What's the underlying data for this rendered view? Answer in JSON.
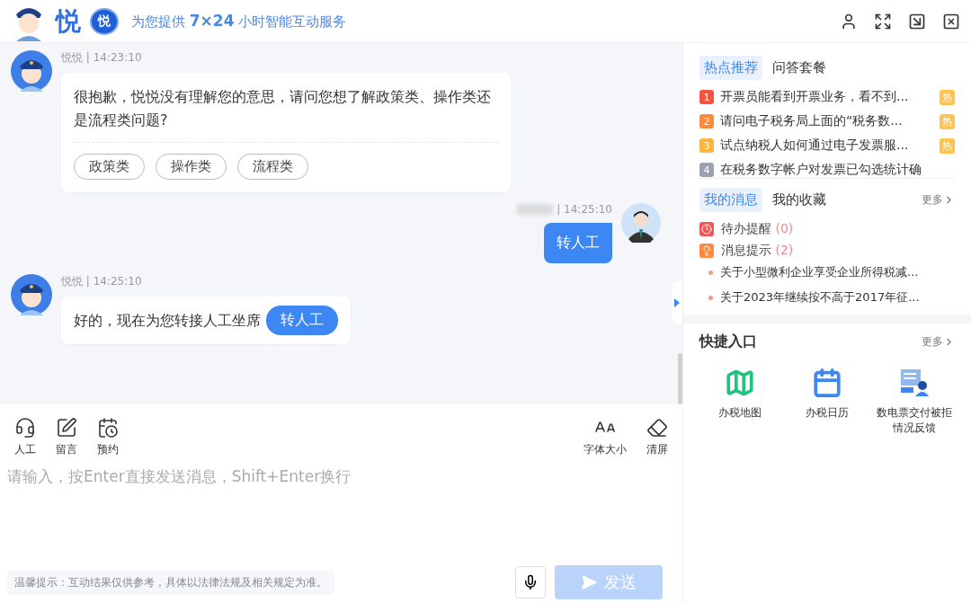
{
  "header": {
    "logo_text": "悦",
    "badge_text": "悦",
    "tagline": "为您提供 **7×24** 小时智能互动服务"
  },
  "messages": [
    {
      "kind": "bot",
      "meta": "悦悦 | 14:23:10",
      "text": "很抱歉，悦悦没有理解您的意思，请问您想了解政策类、操作类还是流程类问题?",
      "options": [
        "政策类",
        "操作类",
        "流程类"
      ]
    },
    {
      "kind": "user",
      "time": "| 14:25:10",
      "text": "转人工"
    },
    {
      "kind": "bot_action",
      "meta": "悦悦 | 14:25:10",
      "text": "好的，现在为您转接人工坐席",
      "action": "转人工"
    }
  ],
  "toolbar": {
    "left": [
      "人工",
      "留言",
      "预约"
    ],
    "right": [
      "字体大小",
      "清屏"
    ]
  },
  "input": {
    "placeholder": "请输入，按Enter直接发送消息，Shift+Enter换行",
    "notice": "温馨提示：互动结果仅供参考，具体以法律法规及相关规定为准。",
    "send": {
      "label": "发送",
      "disabled": true
    }
  },
  "hot": {
    "tabs": [
      {
        "label": "热点推荐",
        "selected": true
      },
      {
        "label": "问答套餐",
        "selected": false
      }
    ],
    "items": [
      {
        "rank": "1",
        "text": "开票员能看到开票业务，看不到...",
        "badge": "热",
        "color": "#f5533d"
      },
      {
        "rank": "2",
        "text": "请问电子税务局上面的“税务数...",
        "badge": "热",
        "color": "#ff8a3d"
      },
      {
        "rank": "3",
        "text": "试点纳税人如何通过电子发票服...",
        "badge": "热",
        "color": "#ffb53d"
      },
      {
        "rank": "4",
        "text": "在税务数字帐户对发票已勾选统计确",
        "color": "#9aa2b1"
      }
    ]
  },
  "inbox": {
    "tabs": [
      {
        "label": "我的消息",
        "selected": true
      },
      {
        "label": "我的收藏",
        "selected": false
      }
    ],
    "more": "更多",
    "groups": [
      {
        "label": "待办提醒",
        "count": "(0)",
        "color": "#f25757"
      },
      {
        "label": "消息提示",
        "count": "(2)",
        "color": "#ff8a3d"
      }
    ],
    "notices": [
      "关于小型微利企业享受企业所得税减...",
      "关于2023年继续按不高于2017年征..."
    ]
  },
  "shortcuts": {
    "title": "快捷入口",
    "more": "更多",
    "items": [
      "办税地图",
      "办税日历",
      "数电票交付被拒情况反馈"
    ]
  }
}
